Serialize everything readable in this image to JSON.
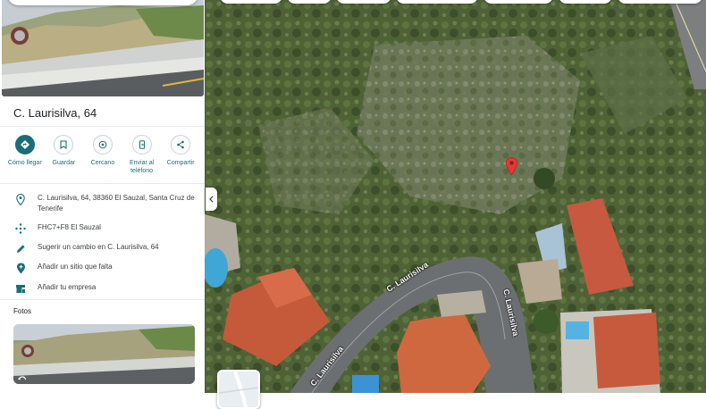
{
  "place": {
    "title": "C. Laurisilva, 64"
  },
  "actions": [
    {
      "label": "Cómo llegar",
      "icon": "directions-icon"
    },
    {
      "label": "Guardar",
      "icon": "bookmark-icon"
    },
    {
      "label": "Cercano",
      "icon": "nearby-icon"
    },
    {
      "label": "Enviar al teléfono",
      "icon": "send-to-phone-icon"
    },
    {
      "label": "Compartir",
      "icon": "share-icon"
    }
  ],
  "info": {
    "address": "C. Laurisilva, 64, 38360 El Sauzal, Santa Cruz de Tenerife",
    "plus_code": "FHC7+F8 El Sauzal",
    "suggest_edit": "Sugerir un cambio en C. Laurisilva, 64",
    "add_place": "Añadir un sitio que falta",
    "add_business": "Añadir tu empresa"
  },
  "photos": {
    "label": "Fotos"
  },
  "map": {
    "street_labels": [
      "C. Laurisilva",
      "C. Laurisilva",
      "C. Laurisilva"
    ],
    "pin_color": "#e53935"
  },
  "colors": {
    "accent": "#1a6e79"
  }
}
